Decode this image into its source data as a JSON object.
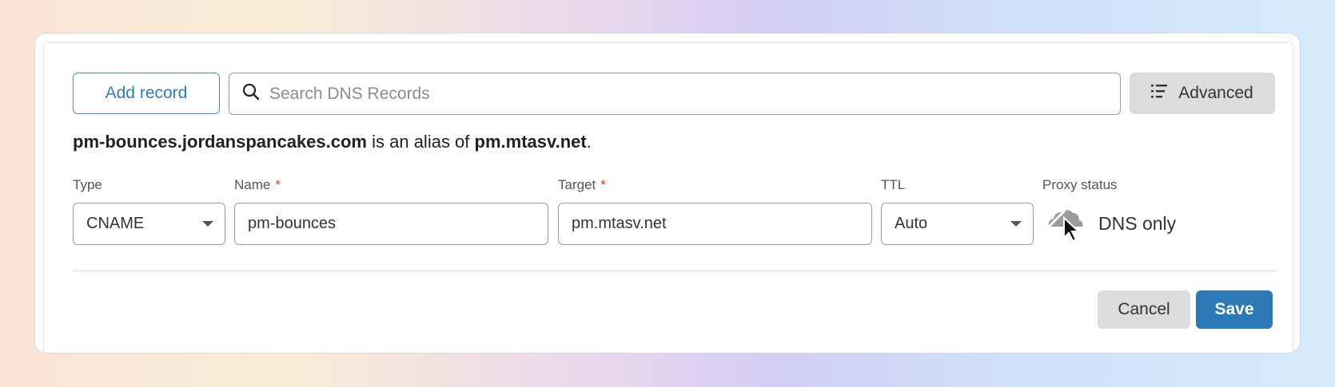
{
  "toolbar": {
    "add_record_label": "Add record",
    "search_placeholder": "Search DNS Records",
    "advanced_label": "Advanced"
  },
  "alias_notice": {
    "host": "pm-bounces.jordanspancakes.com",
    "middle": " is an alias of ",
    "target": "pm.mtasv.net",
    "end": "."
  },
  "form": {
    "type": {
      "label": "Type",
      "value": "CNAME"
    },
    "name": {
      "label": "Name",
      "required_mark": "*",
      "value": "pm-bounces"
    },
    "target": {
      "label": "Target",
      "required_mark": "*",
      "value": "pm.mtasv.net"
    },
    "ttl": {
      "label": "TTL",
      "value": "Auto"
    },
    "proxy_status": {
      "label": "Proxy status",
      "value": "DNS only",
      "icon": "cloud-icon"
    }
  },
  "actions": {
    "cancel_label": "Cancel",
    "save_label": "Save"
  },
  "colors": {
    "accent": "#2c79b7",
    "required": "#d33b3b"
  }
}
